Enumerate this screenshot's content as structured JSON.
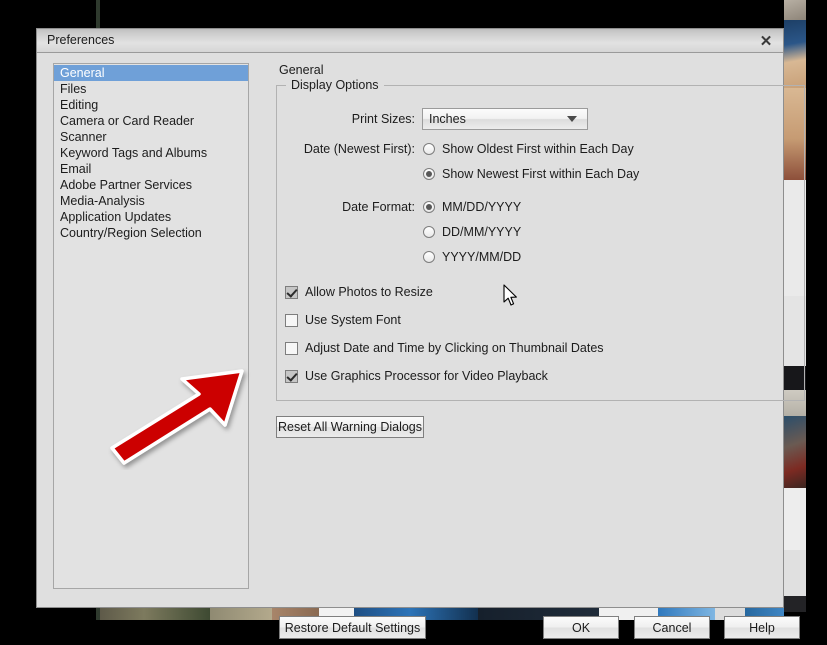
{
  "window": {
    "title": "Preferences",
    "close_icon": "close-icon"
  },
  "sidebar": {
    "items": [
      {
        "label": "General",
        "selected": true
      },
      {
        "label": "Files",
        "selected": false
      },
      {
        "label": "Editing",
        "selected": false
      },
      {
        "label": "Camera or Card Reader",
        "selected": false
      },
      {
        "label": "Scanner",
        "selected": false
      },
      {
        "label": "Keyword Tags and Albums",
        "selected": false
      },
      {
        "label": "Email",
        "selected": false
      },
      {
        "label": "Adobe Partner Services",
        "selected": false
      },
      {
        "label": "Media-Analysis",
        "selected": false
      },
      {
        "label": "Application Updates",
        "selected": false
      },
      {
        "label": "Country/Region Selection",
        "selected": false
      }
    ]
  },
  "content": {
    "heading": "General",
    "group": {
      "legend": "Display Options",
      "print_sizes": {
        "label": "Print Sizes:",
        "value": "Inches",
        "arrow_icon": "chevron-down-icon"
      },
      "date_order": {
        "label": "Date (Newest First):",
        "options": [
          {
            "label": "Show Oldest First within Each Day",
            "selected": false
          },
          {
            "label": "Show Newest First within Each Day",
            "selected": true
          }
        ]
      },
      "date_format": {
        "label": "Date Format:",
        "options": [
          {
            "label": "MM/DD/YYYY",
            "selected": true
          },
          {
            "label": "DD/MM/YYYY",
            "selected": false
          },
          {
            "label": "YYYY/MM/DD",
            "selected": false
          }
        ]
      },
      "checkboxes": [
        {
          "label": "Allow Photos to Resize",
          "checked": true
        },
        {
          "label": "Use System Font",
          "checked": false
        },
        {
          "label": "Adjust Date and Time by Clicking on Thumbnail Dates",
          "checked": false
        },
        {
          "label": "Use Graphics Processor for Video Playback",
          "checked": true
        }
      ],
      "reset_warnings_label": "Reset All Warning Dialogs"
    }
  },
  "footer": {
    "restore_defaults_label": "Restore Default Settings",
    "ok_label": "OK",
    "cancel_label": "Cancel",
    "help_label": "Help"
  },
  "annotation": {
    "arrow_color": "#cc0000",
    "arrow_outline": "#ffffff",
    "points_to": "Use Graphics Processor for Video Playback"
  },
  "colors": {
    "dialog_background": "#dfdfdf",
    "selection_blue": "#6fa0d8",
    "desktop": "#000000"
  }
}
